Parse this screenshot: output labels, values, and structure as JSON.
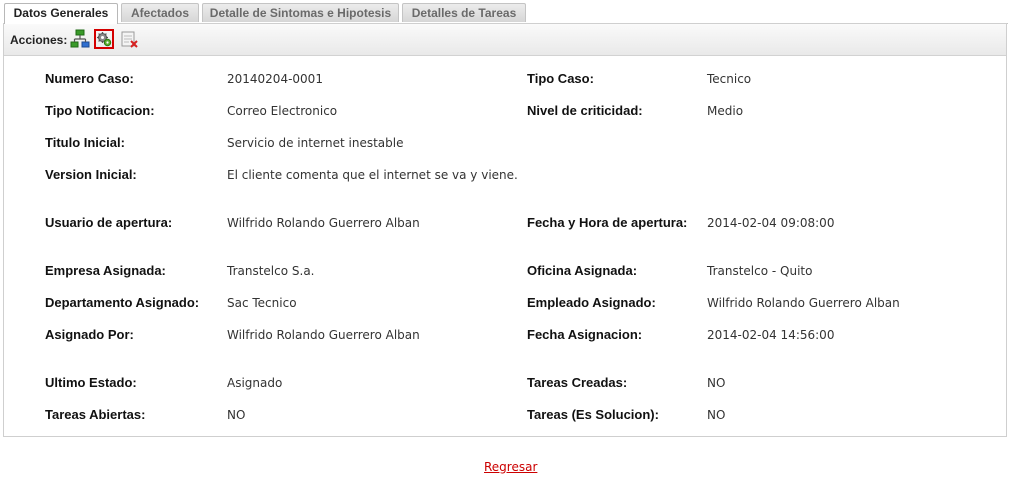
{
  "tabs": [
    {
      "label": "Datos Generales"
    },
    {
      "label": "Afectados"
    },
    {
      "label": "Detalle de Sintomas e Hipotesis"
    },
    {
      "label": "Detalles de Tareas"
    }
  ],
  "toolbar": {
    "label": "Acciones:",
    "icons": [
      "network-icon",
      "gear-settings-icon",
      "close-document-icon"
    ]
  },
  "details": {
    "numero_caso": {
      "label": "Numero Caso:",
      "value": "20140204-0001"
    },
    "tipo_caso": {
      "label": "Tipo Caso:",
      "value": "Tecnico"
    },
    "tipo_notificacion": {
      "label": "Tipo Notificacion:",
      "value": "Correo Electronico"
    },
    "nivel_criticidad": {
      "label": "Nivel de criticidad:",
      "value": "Medio"
    },
    "titulo_inicial": {
      "label": "Titulo Inicial:",
      "value": "Servicio de internet inestable"
    },
    "version_inicial": {
      "label": "Version Inicial:",
      "value": "El cliente comenta que el internet se va y viene."
    },
    "usuario_apertura": {
      "label": "Usuario de apertura:",
      "value": "Wilfrido Rolando Guerrero Alban"
    },
    "fecha_apertura": {
      "label": "Fecha y Hora de apertura:",
      "value": "2014-02-04 09:08:00"
    },
    "empresa_asignada": {
      "label": "Empresa Asignada:",
      "value": "Transtelco S.a."
    },
    "oficina_asignada": {
      "label": "Oficina Asignada:",
      "value": "Transtelco - Quito"
    },
    "departamento_asignado": {
      "label": "Departamento Asignado:",
      "value": "Sac Tecnico"
    },
    "empleado_asignado": {
      "label": "Empleado Asignado:",
      "value": "Wilfrido Rolando Guerrero Alban"
    },
    "asignado_por": {
      "label": "Asignado Por:",
      "value": "Wilfrido Rolando Guerrero Alban"
    },
    "fecha_asignacion": {
      "label": "Fecha Asignacion:",
      "value": "2014-02-04 14:56:00"
    },
    "ultimo_estado": {
      "label": "Ultimo Estado:",
      "value": "Asignado"
    },
    "tareas_creadas": {
      "label": "Tareas Creadas:",
      "value": "NO"
    },
    "tareas_abiertas": {
      "label": "Tareas Abiertas:",
      "value": "NO"
    },
    "tareas_solucion": {
      "label": "Tareas (Es Solucion):",
      "value": "NO"
    }
  },
  "footer": {
    "back_link": "Regresar"
  },
  "colors": {
    "link": "#cc0000",
    "selected_border": "#d40000"
  }
}
